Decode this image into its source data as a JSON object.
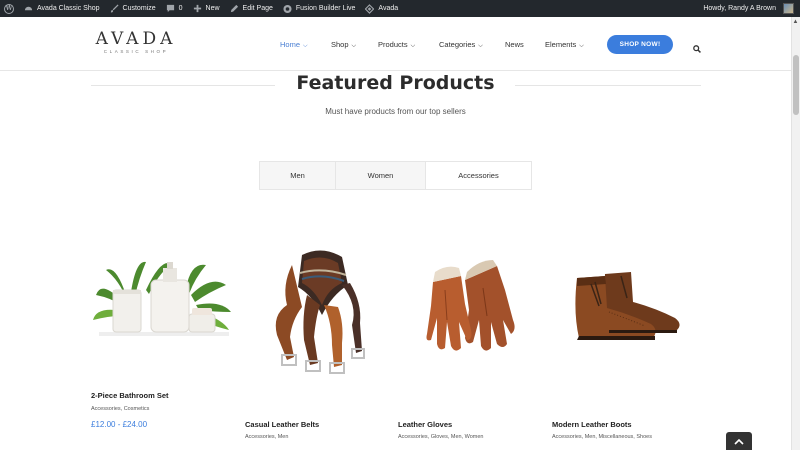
{
  "admin_bar": {
    "items": [
      {
        "label": "",
        "icon": "wordpress-logo-icon"
      },
      {
        "label": "Avada Classic Shop",
        "icon": "dashboard-icon"
      },
      {
        "label": "Customize",
        "icon": "brush-icon"
      },
      {
        "label": "0",
        "icon": "comment-icon"
      },
      {
        "label": "New",
        "icon": "plus-icon"
      },
      {
        "label": "Edit Page",
        "icon": "pencil-icon"
      },
      {
        "label": "Fusion Builder Live",
        "icon": "fusion-icon"
      },
      {
        "label": "Avada",
        "icon": "avada-icon"
      }
    ],
    "greeting": "Howdy, Randy A Brown"
  },
  "header": {
    "logo_main": "AVADA",
    "logo_sub": "CLASSIC SHOP",
    "nav": [
      {
        "label": "Home",
        "dropdown": true,
        "active": true
      },
      {
        "label": "Shop",
        "dropdown": true,
        "active": false
      },
      {
        "label": "Products",
        "dropdown": true,
        "active": false
      },
      {
        "label": "Categories",
        "dropdown": true,
        "active": false
      },
      {
        "label": "News",
        "dropdown": false,
        "active": false
      },
      {
        "label": "Elements",
        "dropdown": true,
        "active": false
      }
    ],
    "cta": "SHOP NOW!",
    "accent": "#3b7ddd"
  },
  "section": {
    "title": "Featured Products",
    "subtitle": "Must have products from our top sellers"
  },
  "tabs": [
    {
      "label": "Men"
    },
    {
      "label": "Women"
    },
    {
      "label": "Accessories"
    }
  ],
  "products": [
    {
      "name": "2-Piece Bathroom Set",
      "categories": "Accessories, Cosmetics",
      "price": "£12.00 - £24.00",
      "image": "bathroom-set-image"
    },
    {
      "name": "Casual Leather Belts",
      "categories": "Accessories, Men",
      "price": "",
      "image": "leather-belts-image"
    },
    {
      "name": "Leather Gloves",
      "categories": "Accessories, Gloves, Men, Women",
      "price": "",
      "image": "leather-gloves-image"
    },
    {
      "name": "Modern Leather Boots",
      "categories": "Accessories, Men, Miscellaneous, Shoes",
      "price": "",
      "image": "leather-boots-image"
    }
  ]
}
